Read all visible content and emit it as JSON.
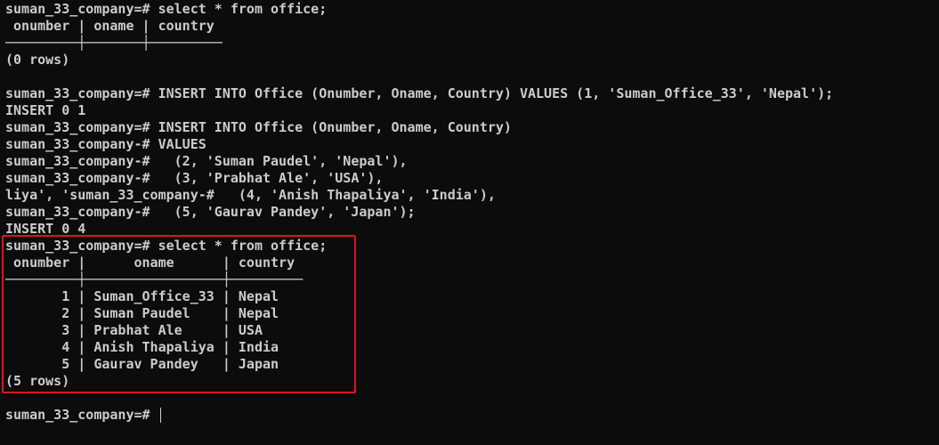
{
  "terminal": {
    "lines": [
      "suman_33_company=# select * from office;",
      " onumber | oname | country",
      "─────────┼───────┼─────────",
      "(0 rows)",
      "",
      "suman_33_company=# INSERT INTO Office (Onumber, Oname, Country) VALUES (1, 'Suman_Office_33', 'Nepal');",
      "INSERT 0 1",
      "suman_33_company=# INSERT INTO Office (Onumber, Oname, Country)",
      "suman_33_company-# VALUES",
      "suman_33_company-#   (2, 'Suman Paudel', 'Nepal'),",
      "suman_33_company-#   (3, 'Prabhat Ale', 'USA'),",
      "liya', 'suman_33_company-#   (4, 'Anish Thapaliya', 'India'),",
      "suman_33_company-#   (5, 'Gaurav Pandey', 'Japan');",
      "INSERT 0 4",
      "suman_33_company=# select * from office;",
      " onumber |      oname      | country",
      "─────────┼─────────────────┼─────────",
      "       1 | Suman_Office_33 | Nepal",
      "       2 | Suman Paudel    | Nepal",
      "       3 | Prabhat Ale     | USA",
      "       4 | Anish Thapaliya | India",
      "       5 | Gaurav Pandey   | Japan",
      "(5 rows)",
      "",
      "suman_33_company=# "
    ]
  },
  "colors": {
    "background": "#0c0c0c",
    "text": "#cccccc",
    "highlight_border": "#e0141e"
  }
}
